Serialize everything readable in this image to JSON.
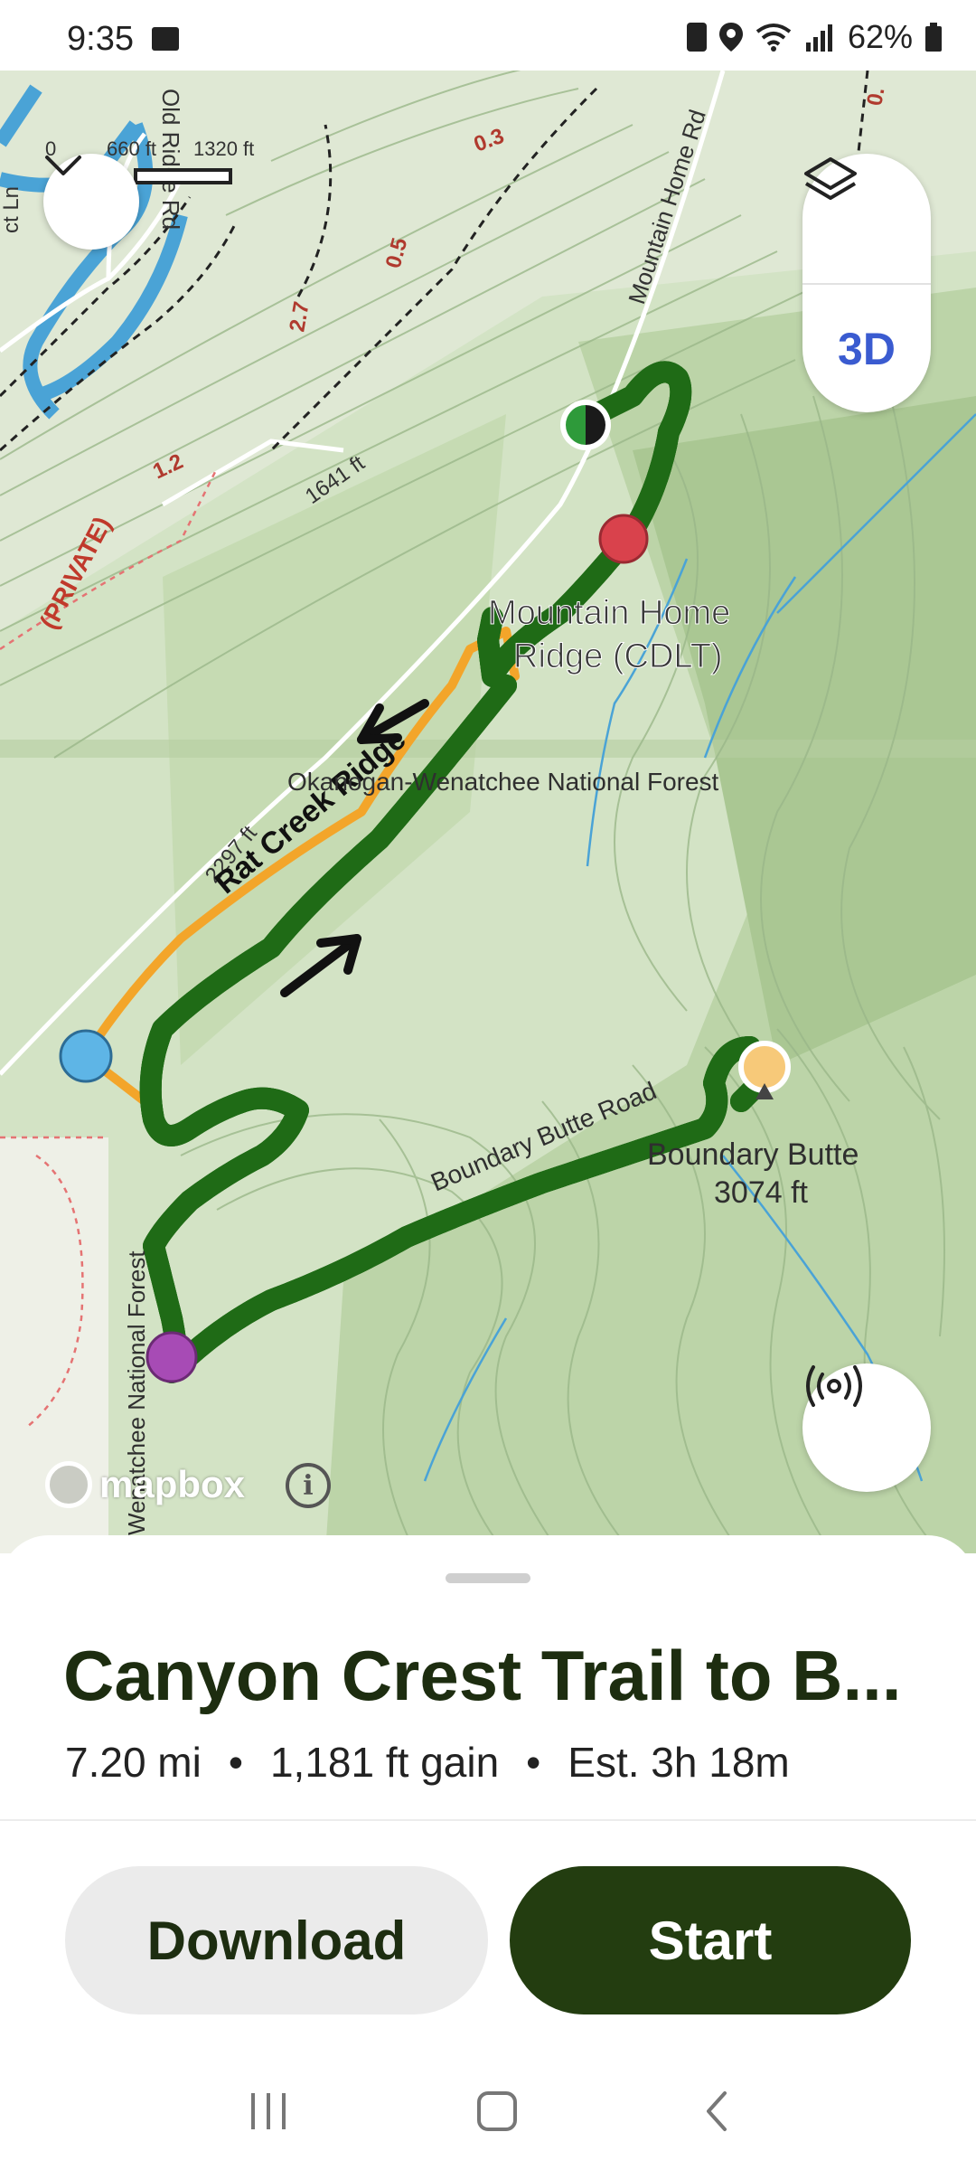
{
  "status": {
    "time": "9:35",
    "battery": "62%",
    "icons": [
      "image-icon",
      "recycle-icon",
      "location-icon",
      "wifi-icon",
      "signal-icon",
      "battery-icon"
    ]
  },
  "map": {
    "scale": {
      "label_0": "0",
      "label_1": "660 ft",
      "label_2": "1320 ft"
    },
    "labels": {
      "old_ridge_rd": "Old Ridge Rd",
      "mountain_home_rd": "Mountain Home Rd",
      "private": "(PRIVATE)",
      "elev_1641": "1641 ft",
      "elev_2297": "2297 ft",
      "dist_03": "0.3",
      "dist_05": "0.5",
      "dist_27": "2.7",
      "dist_12": "1.2",
      "dist_top": "0.",
      "mountain_home_ridge_1": "Mountain Home",
      "mountain_home_ridge_2": "Ridge (CDLT)",
      "rat_creek_ridge": "Rat Creek Ridge",
      "okanogan": "Okanogan-Wenatchee National Forest",
      "wenatchee_vertical": "Wenatchee National Forest",
      "boundary_butte_road": "Boundary Butte Road",
      "boundary_butte_1": "Boundary Butte",
      "boundary_butte_2": "3074 ft",
      "edge_ln": "ct Ln"
    },
    "layers_icon": "layers-icon",
    "btn_3d": "3D",
    "broadcast_icon": "broadcast-icon",
    "attribution": "mapbox",
    "colors": {
      "trail_green": "#3fc13a",
      "trail_dark": "#1f6b16",
      "orange_route": "#f3a52a",
      "water": "#4aa3d6"
    }
  },
  "sheet": {
    "title": "Canyon Crest Trail to B...",
    "distance": "7.20 mi",
    "gain": "1,181 ft gain",
    "time": "Est. 3h 18m",
    "separator": "•",
    "download_label": "Download",
    "start_label": "Start"
  },
  "nav": {
    "icons": [
      "recents-icon",
      "home-icon",
      "back-icon"
    ]
  }
}
